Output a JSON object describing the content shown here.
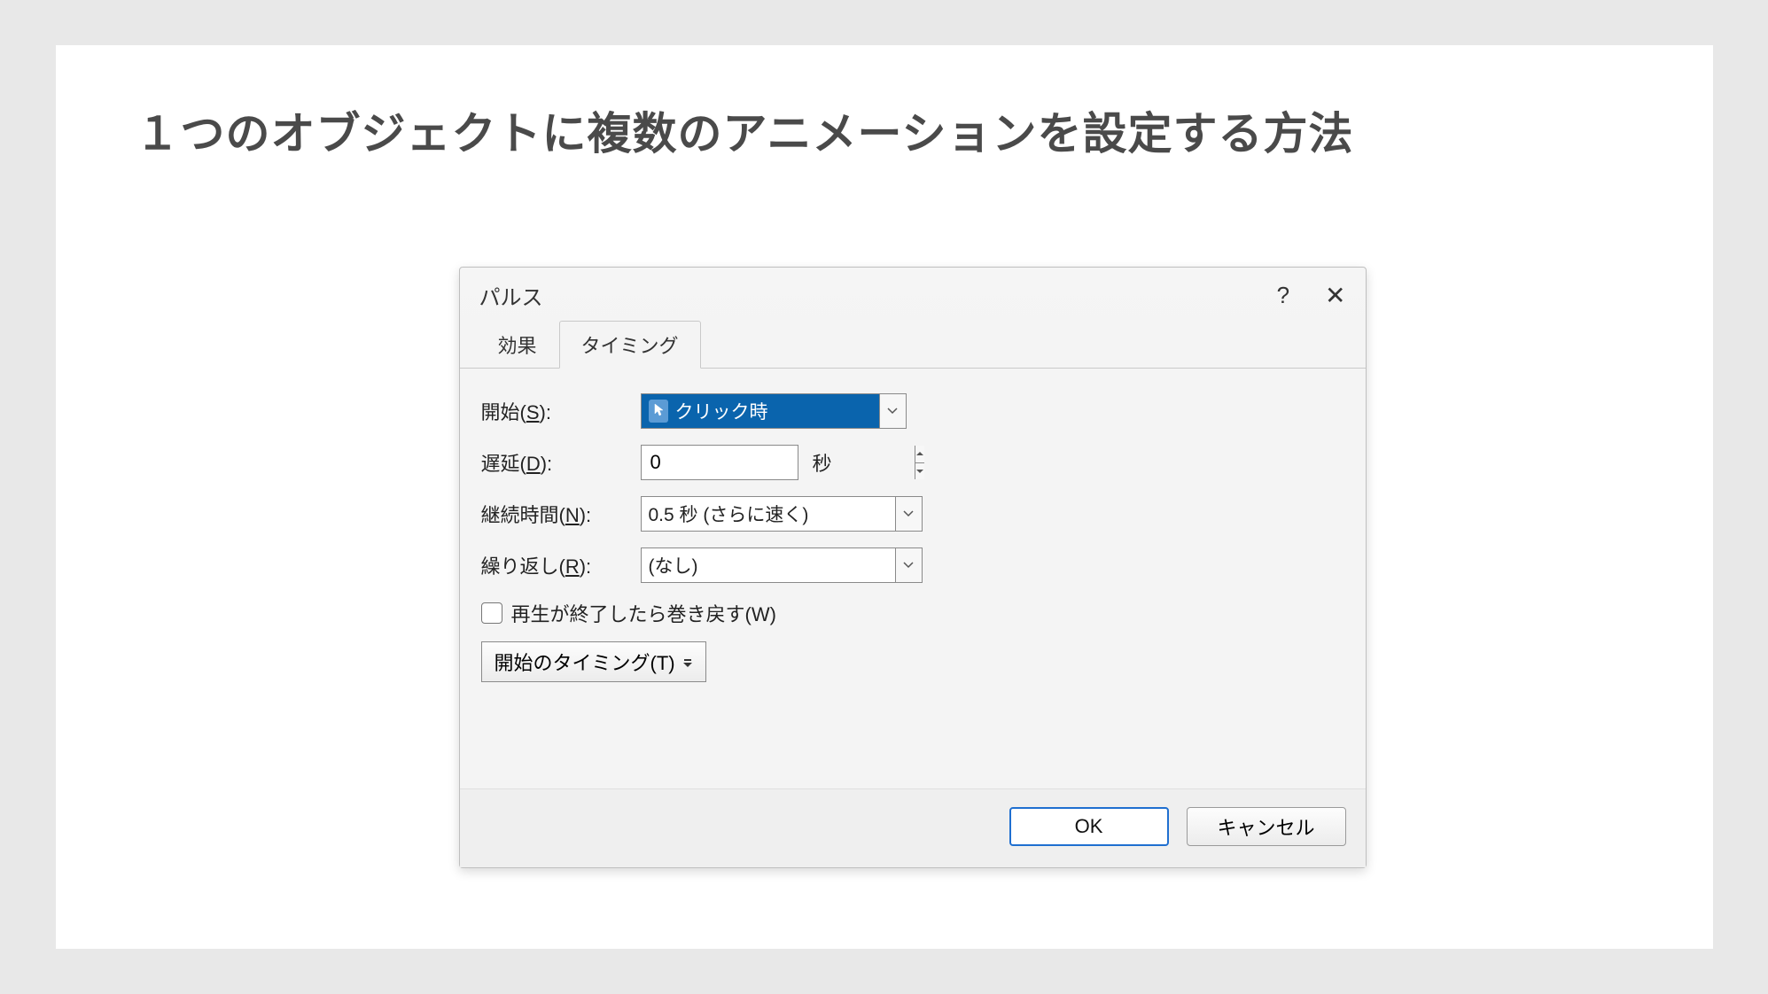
{
  "heading": "１つのオブジェクトに複数のアニメーションを設定する方法",
  "dialog": {
    "title": "パルス",
    "tabs": {
      "effect": "効果",
      "timing": "タイミング"
    },
    "fields": {
      "start": {
        "label_pre": "開始(",
        "label_key": "S",
        "label_post": "):",
        "value": "クリック時"
      },
      "delay": {
        "label_pre": "遅延(",
        "label_key": "D",
        "label_post": "):",
        "value": "0",
        "unit": "秒"
      },
      "duration": {
        "label_pre": "継続時間(",
        "label_key": "N",
        "label_post": "):",
        "value": "0.5 秒 (さらに速く)"
      },
      "repeat": {
        "label_pre": "繰り返し(",
        "label_key": "R",
        "label_post": "):",
        "value": "(なし)"
      },
      "rewind": {
        "label_pre": "再生が終了したら巻き戻す(",
        "label_key": "W",
        "label_post": ")"
      },
      "trigger": {
        "label_pre": "開始のタイミング(",
        "label_key": "T",
        "label_post": ")"
      }
    },
    "buttons": {
      "ok": "OK",
      "cancel": "キャンセル"
    }
  }
}
